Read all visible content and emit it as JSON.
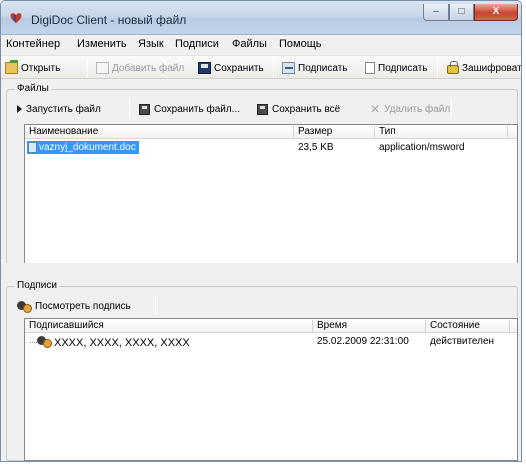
{
  "window": {
    "title": "DigiDoc Client - новый файл"
  },
  "title_buttons": {
    "minimize": "–",
    "maximize": "□",
    "close": "X"
  },
  "menu": [
    "Контейнер",
    "Изменить",
    "Язык",
    "Подписи",
    "Файлы",
    "Помощь"
  ],
  "toolbar": {
    "open": "Открыть",
    "add_file": "Добавить файл",
    "save": "Сохранить",
    "sign_card": "Подписать",
    "sign": "Подписать",
    "encrypt": "Зашифроват"
  },
  "files": {
    "group_title": "Файлы",
    "actions": {
      "run": "Запустить файл",
      "save_file": "Сохранить файл...",
      "save_all": "Сохранить всё",
      "delete": "Удалить файл"
    },
    "columns": [
      "Наименование",
      "Размер",
      "Тип"
    ],
    "rows": [
      {
        "name": "vaznyj_dokument.doc",
        "size": "23,5 KB",
        "type": "application/msword"
      }
    ]
  },
  "signatures": {
    "group_title": "Подписи",
    "view_button": "Посмотреть подпись",
    "columns": [
      "Подписавшийся",
      "Время",
      "Состояние"
    ],
    "rows": [
      {
        "signer": "XXXX, XXXX, XXXX, XXXX",
        "time": "25.02.2009 22:31:00",
        "status": "действителен"
      }
    ]
  }
}
